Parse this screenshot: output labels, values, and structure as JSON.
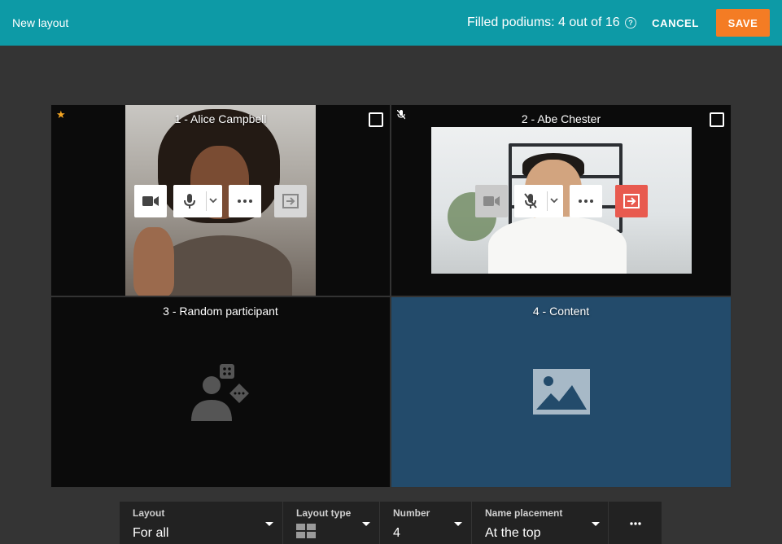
{
  "topbar": {
    "title": "New layout",
    "filled_text": "Filled podiums: 4 out of 16",
    "help_icon": "?",
    "cancel_label": "CANCEL",
    "save_label": "SAVE",
    "bar_color": "#0d9aa6",
    "save_color": "#f47c24"
  },
  "tiles": [
    {
      "label": "1 - Alice Campbell",
      "badge": "star-icon",
      "badge_glyph": "★",
      "mic_muted": false,
      "camera_enabled": true,
      "exit_active": false,
      "selected": false
    },
    {
      "label": "2 - Abe Chester",
      "badge": "mic-muted-icon",
      "mic_muted": true,
      "camera_enabled": false,
      "exit_active": true,
      "selected": false
    },
    {
      "label": "3 - Random participant",
      "placeholder": "random-participant-icon"
    },
    {
      "label": "4 - Content",
      "placeholder": "image-placeholder-icon",
      "background": "#234b6b"
    }
  ],
  "toolbar": {
    "layout": {
      "label": "Layout",
      "value": "For all"
    },
    "layout_type": {
      "label": "Layout type",
      "icon": "grid-2x2-icon"
    },
    "number": {
      "label": "Number",
      "value": "4"
    },
    "name_placement": {
      "label": "Name placement",
      "value": "At the top"
    },
    "more": {
      "icon": "more-horizontal-icon"
    }
  },
  "colors": {
    "exit_active": "#e85a4f",
    "star": "#f5a623",
    "page_bg": "#343434"
  }
}
